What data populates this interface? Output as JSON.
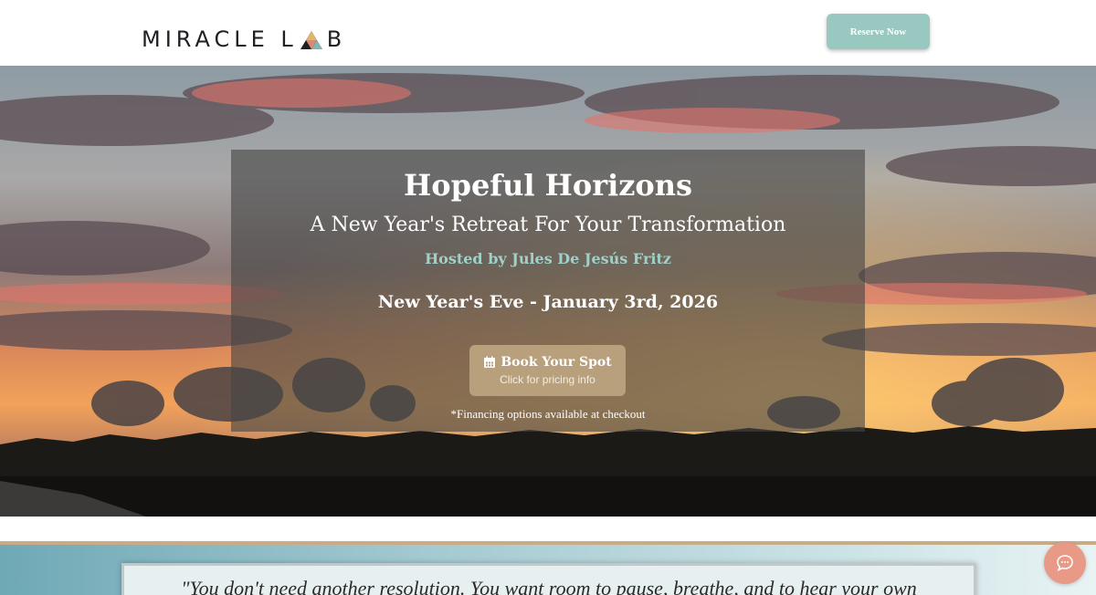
{
  "header": {
    "logo_left": "MIRACLE L",
    "logo_right": "B",
    "reserve_label": "Reserve Now"
  },
  "hero": {
    "title": "Hopeful Horizons",
    "subtitle": "A New Year's Retreat For Your Transformation",
    "host": "Hosted by Jules De Jesús Fritz",
    "date": "New Year's Eve - January 3rd, 2026",
    "book_label": "Book Your Spot",
    "book_sub": "Click for pricing info",
    "financing_note": "*Financing options available at checkout",
    "background": "sunset-over-treeline-image"
  },
  "quote": {
    "text": "\"You don't need another resolution. You want room to pause, breathe, and to hear your own"
  },
  "chat": {
    "icon": "chat-bubble-icon"
  },
  "colors": {
    "reserve_button": "#99c8c0",
    "host_text": "#9fd0c9",
    "book_button": "#b8a07c",
    "chat_button": "#e99a86",
    "divider": "#c8ab87"
  }
}
